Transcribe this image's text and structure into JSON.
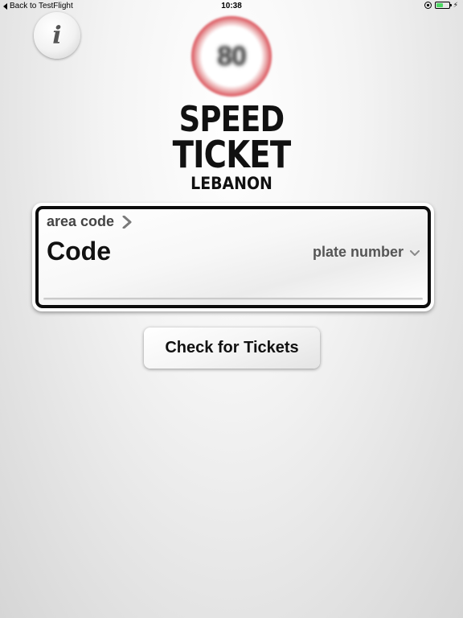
{
  "status_bar": {
    "back_label": "Back to TestFlight",
    "time": "10:38",
    "battery_color": "#4cd964",
    "battery_level": 0.55,
    "icons": [
      "rotation-lock-icon",
      "battery-icon",
      "charging-icon"
    ]
  },
  "info_button": {
    "glyph": "i",
    "icon": "info-icon"
  },
  "logo": {
    "speed_value": "80",
    "ring_color": "#d22c36"
  },
  "title": {
    "line1": "SPEED",
    "line2": "TICKET",
    "country": "LEBANON"
  },
  "plate_form": {
    "area_code_label": "area code",
    "area_code_icon": "chevron-right-icon",
    "code_placeholder": "Code",
    "plate_number_placeholder": "plate number",
    "plate_number_icon": "chevron-down-icon"
  },
  "actions": {
    "check_label": "Check for Tickets"
  }
}
